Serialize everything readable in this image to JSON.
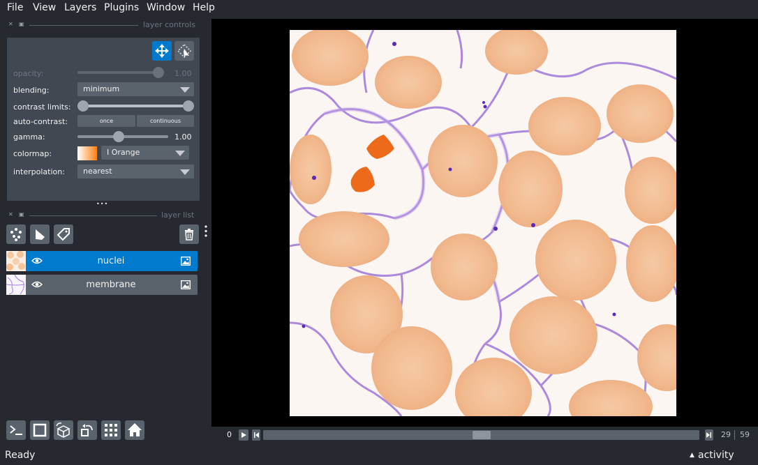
{
  "menu": [
    "File",
    "View",
    "Layers",
    "Plugins",
    "Window",
    "Help"
  ],
  "layer_controls": {
    "header": "layer controls",
    "opacity_label": "opacity:",
    "opacity_value": "1.00",
    "opacity_level": 1.0,
    "blending_label": "blending:",
    "blending_value": "minimum",
    "contrast_label": "contrast limits:",
    "contrast_range": [
      0.0,
      1.0
    ],
    "auto_contrast_label": "auto-contrast:",
    "once_label": "once",
    "continuous_label": "continuous",
    "gamma_label": "gamma:",
    "gamma_value": "1.00",
    "gamma_level": 0.45,
    "colormap_label": "colormap:",
    "colormap_value": "I Orange",
    "interpolation_label": "interpolation:",
    "interpolation_value": "nearest",
    "more_dots": "•••"
  },
  "layer_list": {
    "header": "layer list",
    "layers": [
      {
        "name": "nuclei",
        "selected": true,
        "visible": true
      },
      {
        "name": "membrane",
        "selected": false,
        "visible": true
      }
    ]
  },
  "dims": {
    "start": "0",
    "current": "29",
    "total": "59",
    "position": 0.5
  },
  "status": {
    "text": "Ready",
    "activity_label": "activity",
    "activity_arrow": "▲"
  },
  "colors": {
    "background": "#262930",
    "panel": "#414851",
    "accent": "#007acc",
    "colormap": "#ff7f0e"
  }
}
